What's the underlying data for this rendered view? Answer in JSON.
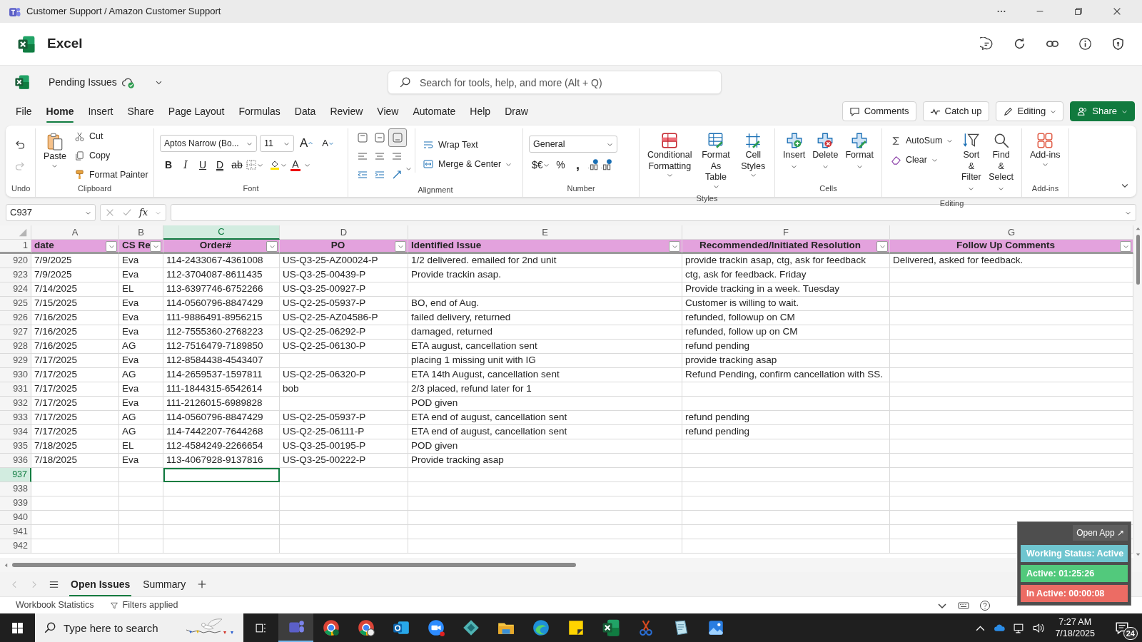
{
  "window": {
    "title": "Customer Support / Amazon Customer Support"
  },
  "app": {
    "name": "Excel"
  },
  "document": {
    "name": "Pending Issues"
  },
  "search": {
    "placeholder": "Search for tools, help, and more (Alt + Q)"
  },
  "menu_tabs": [
    {
      "label": "File",
      "selected": false
    },
    {
      "label": "Home",
      "selected": true
    },
    {
      "label": "Insert",
      "selected": false
    },
    {
      "label": "Share",
      "selected": false
    },
    {
      "label": "Page Layout",
      "selected": false
    },
    {
      "label": "Formulas",
      "selected": false
    },
    {
      "label": "Data",
      "selected": false
    },
    {
      "label": "Review",
      "selected": false
    },
    {
      "label": "View",
      "selected": false
    },
    {
      "label": "Automate",
      "selected": false
    },
    {
      "label": "Help",
      "selected": false
    },
    {
      "label": "Draw",
      "selected": false
    }
  ],
  "header_buttons": [
    {
      "label": "Comments",
      "kind": "comments"
    },
    {
      "label": "Catch up",
      "kind": "catchup"
    },
    {
      "label": "Editing",
      "kind": "editing"
    },
    {
      "label": "Share",
      "kind": "share"
    }
  ],
  "ribbon": {
    "undo": {
      "label": "Undo",
      "redo_disabled": true
    },
    "clipboard": {
      "label": "Clipboard",
      "paste": "Paste",
      "commands": [
        "Cut",
        "Copy",
        "Format Painter"
      ]
    },
    "font": {
      "label": "Font",
      "font_name": "Aptos Narrow (Bo...",
      "font_size": "11",
      "grow": "A",
      "shrink": "A",
      "styles": [
        "B",
        "I",
        "U",
        "D",
        "ab"
      ],
      "color_button": "A"
    },
    "alignment": {
      "label": "Alignment",
      "vertical_align": [
        {
          "selected": false
        },
        {
          "selected": false
        },
        {
          "selected": true
        }
      ],
      "commands": [
        "Wrap Text",
        "Merge & Center"
      ]
    },
    "number": {
      "label": "Number",
      "format": "General",
      "currency": "$€",
      "percent": "%",
      "comma": ","
    },
    "styles": {
      "label": "Styles",
      "commands": [
        "Conditional Formatting",
        "Format As Table",
        "Cell Styles"
      ]
    },
    "cells": {
      "label": "Cells",
      "commands": [
        "Insert",
        "Delete",
        "Format"
      ]
    },
    "editing": {
      "label": "Editing",
      "small": [
        "AutoSum",
        "Clear"
      ],
      "commands": [
        "Sort & Filter",
        "Find & Select"
      ]
    },
    "addins": {
      "label": "Add-ins",
      "commands": [
        "Add-ins"
      ]
    }
  },
  "formula_bar": {
    "name_box": "C937",
    "fx": "fx"
  },
  "sheet": {
    "header_row": "1",
    "columns": [
      {
        "letter": "A",
        "header": "date",
        "selected": false
      },
      {
        "letter": "B",
        "header": "CS Re",
        "selected": false
      },
      {
        "letter": "C",
        "header": "Order#",
        "selected": true
      },
      {
        "letter": "D",
        "header": "PO",
        "selected": false
      },
      {
        "letter": "E",
        "header": "Identified Issue",
        "selected": false
      },
      {
        "letter": "F",
        "header": "Recommended/Initiated Resolution",
        "selected": false
      },
      {
        "letter": "G",
        "header": "Follow Up Comments",
        "selected": false
      }
    ],
    "rows": [
      {
        "number": "920",
        "selected": false,
        "cells": {
          "A": "7/9/2025",
          "B": "Eva",
          "C": "114-2433067-4361008",
          "D": "US-Q3-25-AZ00024-P",
          "E": "1/2 delivered. emailed for 2nd unit",
          "F": "provide trackin asap, ctg, ask for feedback",
          "G": "Delivered, asked for feedback."
        }
      },
      {
        "number": "923",
        "selected": false,
        "cells": {
          "A": "7/9/2025",
          "B": "Eva",
          "C": "112-3704087-8611435",
          "D": "US-Q3-25-00439-P",
          "E": "Provide trackin asap.",
          "F": "ctg, ask for feedback. Friday"
        }
      },
      {
        "number": "924",
        "selected": false,
        "cells": {
          "A": "7/14/2025",
          "B": "EL",
          "C": "113-6397746-6752266",
          "D": "US-Q3-25-00927-P",
          "F": "Provide tracking in a week. Tuesday"
        }
      },
      {
        "number": "925",
        "selected": false,
        "cells": {
          "A": "7/15/2025",
          "B": "Eva",
          "C": "114-0560796-8847429",
          "D": "US-Q2-25-05937-P",
          "E": "BO, end of Aug.",
          "F": "Customer is willing to wait."
        }
      },
      {
        "number": "926",
        "selected": false,
        "cells": {
          "A": "7/16/2025",
          "B": "Eva",
          "C": "111-9886491-8956215",
          "D": "US-Q2-25-AZ04586-P",
          "E": "failed delivery, returned",
          "F": "refunded, followup on CM"
        }
      },
      {
        "number": "927",
        "selected": false,
        "cells": {
          "A": "7/16/2025",
          "B": "Eva",
          "C": "112-7555360-2768223",
          "D": "US-Q2-25-06292-P",
          "E": "damaged, returned",
          "F": "refunded, follow up on CM"
        }
      },
      {
        "number": "928",
        "selected": false,
        "cells": {
          "A": "7/16/2025",
          "B": "AG",
          "C": "112-7516479-7189850",
          "D": "US-Q2-25-06130-P",
          "E": "ETA august, cancellation sent",
          "F": "refund pending"
        }
      },
      {
        "number": "929",
        "selected": false,
        "cells": {
          "A": "7/17/2025",
          "B": "Eva",
          "C": "112-8584438-4543407",
          "E": "placing 1 missing unit with IG",
          "F": "provide tracking asap"
        }
      },
      {
        "number": "930",
        "selected": false,
        "cells": {
          "A": "7/17/2025",
          "B": "AG",
          "C": "114-2659537-1597811",
          "D": "US-Q2-25-06320-P",
          "E": "ETA 14th August, cancellation sent",
          "F": "Refund Pending, confirm cancellation with SS."
        }
      },
      {
        "number": "931",
        "selected": false,
        "cells": {
          "A": "7/17/2025",
          "B": "Eva",
          "C": "111-1844315-6542614",
          "D": "bob",
          "E": "2/3 placed, refund later for 1"
        }
      },
      {
        "number": "932",
        "selected": false,
        "cells": {
          "A": "7/17/2025",
          "B": "Eva",
          "C": "111-2126015-6989828",
          "E": "POD given"
        }
      },
      {
        "number": "933",
        "selected": false,
        "cells": {
          "A": "7/17/2025",
          "B": "AG",
          "C": "114-0560796-8847429",
          "D": "US-Q2-25-05937-P",
          "E": "ETA end of august, cancellation sent",
          "F": "refund pending"
        }
      },
      {
        "number": "934",
        "selected": false,
        "cells": {
          "A": "7/17/2025",
          "B": "AG",
          "C": "114-7442207-7644268",
          "D": "US-Q2-25-06111-P",
          "E": "ETA end of august, cancellation sent",
          "F": "refund pending"
        }
      },
      {
        "number": "935",
        "selected": false,
        "cells": {
          "A": "7/18/2025",
          "B": "EL",
          "C": "112-4584249-2266654",
          "D": "US-Q3-25-00195-P",
          "E": "POD given"
        }
      },
      {
        "number": "936",
        "selected": false,
        "cells": {
          "A": "7/18/2025",
          "B": "Eva",
          "C": "113-4067928-9137816",
          "D": "US-Q3-25-00222-P",
          "E": "Provide tracking asap"
        }
      },
      {
        "number": "937",
        "selected": true
      },
      {
        "number": "938",
        "selected": false
      },
      {
        "number": "939",
        "selected": false
      },
      {
        "number": "940",
        "selected": false
      },
      {
        "number": "941",
        "selected": false
      },
      {
        "number": "942",
        "selected": false
      }
    ]
  },
  "sheet_tabs": [
    {
      "label": "Open Issues",
      "selected": true
    },
    {
      "label": "Summary",
      "selected": false
    }
  ],
  "status_bar": {
    "statistics": "Workbook Statistics",
    "filters": "Filters applied"
  },
  "tracker": {
    "button": "Open App ↗",
    "entries": [
      {
        "text": "Working Status: Active",
        "color": "#6fc5cf"
      },
      {
        "text": "Active: 01:25:26",
        "color": "#52c97c"
      },
      {
        "text": "In Active: 00:00:08",
        "color": "#ec6c64"
      }
    ]
  },
  "taskbar": {
    "search_placeholder": "Type here to search",
    "time": "7:27 AM",
    "date": "7/18/2025",
    "notifications": "24",
    "apps": [
      {
        "kind": "teams",
        "selected": true
      },
      {
        "kind": "chrome",
        "selected": false
      },
      {
        "kind": "chrome-profile",
        "selected": false
      },
      {
        "kind": "outlook",
        "selected": false
      },
      {
        "kind": "zoom",
        "selected": false
      },
      {
        "kind": "diamond",
        "selected": false
      },
      {
        "kind": "folder",
        "selected": false
      },
      {
        "kind": "edge",
        "selected": false
      },
      {
        "kind": "sticky",
        "selected": false
      },
      {
        "kind": "excel",
        "selected": false
      },
      {
        "kind": "scissors",
        "selected": false
      },
      {
        "kind": "notepad",
        "selected": false
      },
      {
        "kind": "photos",
        "selected": false
      }
    ]
  }
}
